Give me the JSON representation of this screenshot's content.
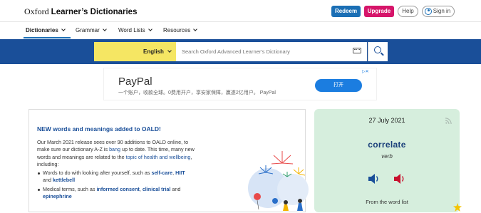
{
  "header": {
    "logo_prefix": "Oxford",
    "logo_main": "Learner’s Dictionaries",
    "redeem_label": "Redeem",
    "upgrade_label": "Upgrade",
    "help_label": "Help",
    "signin_label": "Sign in"
  },
  "nav": {
    "items": [
      {
        "label": "Dictionaries"
      },
      {
        "label": "Grammar"
      },
      {
        "label": "Word Lists"
      },
      {
        "label": "Resources"
      }
    ]
  },
  "search": {
    "language": "English",
    "placeholder": "Search Oxford Advanced Learner's Dictionary"
  },
  "ad": {
    "title": "PayPal",
    "subtitle": "一个账户，收款全球。0费用开户，享安家保障，赢遂2亿用户。 PayPal",
    "cta": "打开"
  },
  "news": {
    "title": "NEW words and meanings added to OALD!",
    "p1_a": "Our March 2021 release sees over 90 additions to OALD online, to make sure our dictionary A-Z is ",
    "p1_link1": "bang",
    "p1_b": " up to date. This time, many new words and meanings are related to the ",
    "p1_link2": "topic of health and wellbeing",
    "p1_c": ", including:",
    "b1_a": "Words to do with looking after yourself, such as ",
    "b1_link1": "self-care",
    "b1_sep": ", ",
    "b1_link2": "HIIT",
    "b1_and": " and ",
    "b1_link3": "kettlebell",
    "b2_a": "Medical terms, such as ",
    "b2_link1": "informed consent",
    "b2_sep": ", ",
    "b2_link2": "clinical trial",
    "b2_and": " and",
    "b2_link3": "epinephrine"
  },
  "wotd": {
    "date": "27 July 2021",
    "word": "correlate",
    "pos": "verb",
    "from": "From the word list"
  },
  "colors": {
    "brand_blue": "#1a4f99",
    "upgrade_pink": "#d6156a",
    "search_yellow": "#f5e663",
    "wotd_green": "#d6eedd"
  }
}
